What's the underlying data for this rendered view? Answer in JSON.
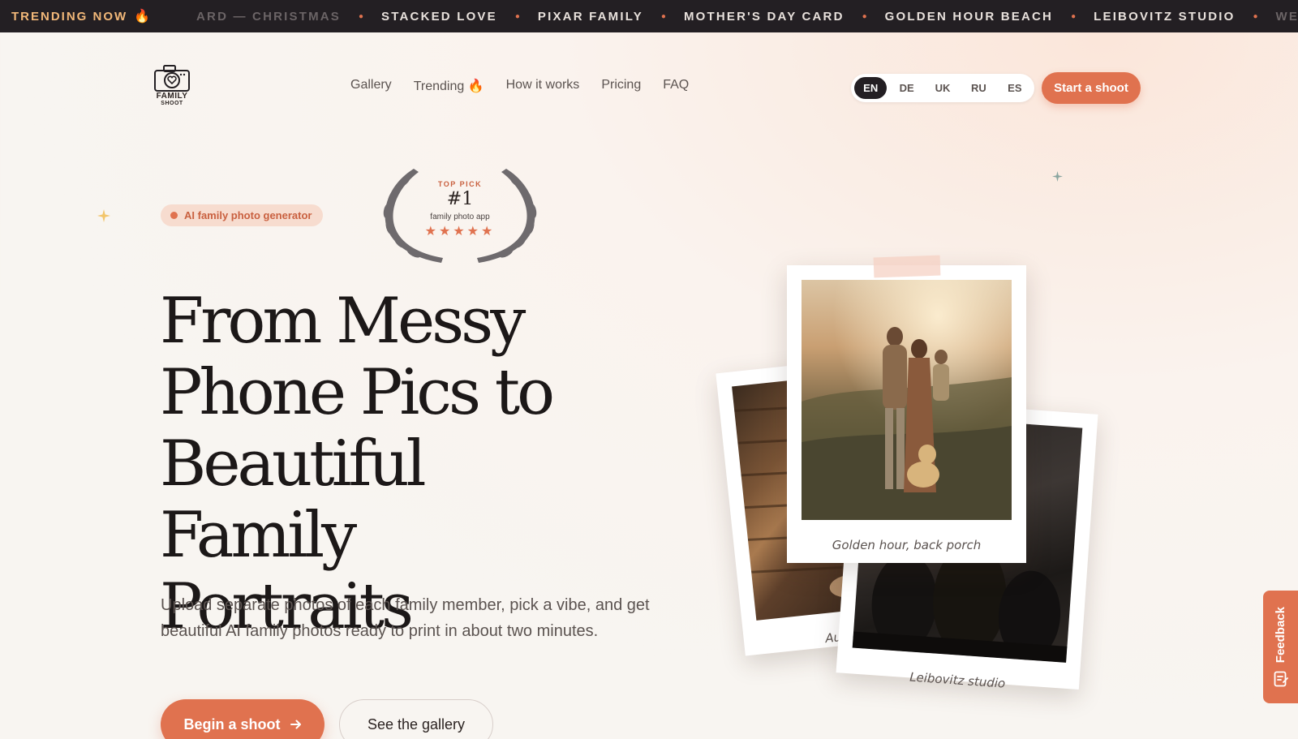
{
  "ticker": {
    "label": "TRENDING NOW",
    "label_icon": "flame-icon",
    "items": [
      "ARD — CHRISTMAS",
      "STACKED LOVE",
      "PIXAR FAMILY",
      "MOTHER'S DAY CARD",
      "GOLDEN HOUR BEACH",
      "LEIBOVITZ STUDIO",
      "WES"
    ]
  },
  "brand": {
    "word1": "FAMILY",
    "word2": "SHOOT"
  },
  "nav": {
    "gallery": "Gallery",
    "trending": "Trending",
    "how": "How it works",
    "pricing": "Pricing",
    "faq": "FAQ"
  },
  "languages": [
    "EN",
    "DE",
    "UK",
    "RU",
    "ES"
  ],
  "active_language": "EN",
  "start_label": "Start a shoot",
  "hero": {
    "badge": "AI family photo generator",
    "award_top": "TOP PICK",
    "award_num": "#1",
    "award_sub": "family photo app",
    "award_stars": "★★★★★",
    "title_lines": [
      "From Messy",
      "Phone Pics to",
      "Beautiful Family",
      "Portraits"
    ],
    "subtitle": "Upload separate photos of each family member, pick a vibe, and get beautiful AI family photos ready to print in about two minutes.",
    "primary_cta": "Begin a shoot",
    "secondary_cta": "See the gallery"
  },
  "polaroids": {
    "main_caption": "Golden hour, back porch",
    "left_caption": "Au",
    "right_caption": "Leibovitz studio"
  },
  "feedback_label": "Feedback",
  "colors": {
    "accent": "#e0724f",
    "dark": "#231f23",
    "badge_bg": "#f7dccf",
    "gold": "#f2b879"
  }
}
